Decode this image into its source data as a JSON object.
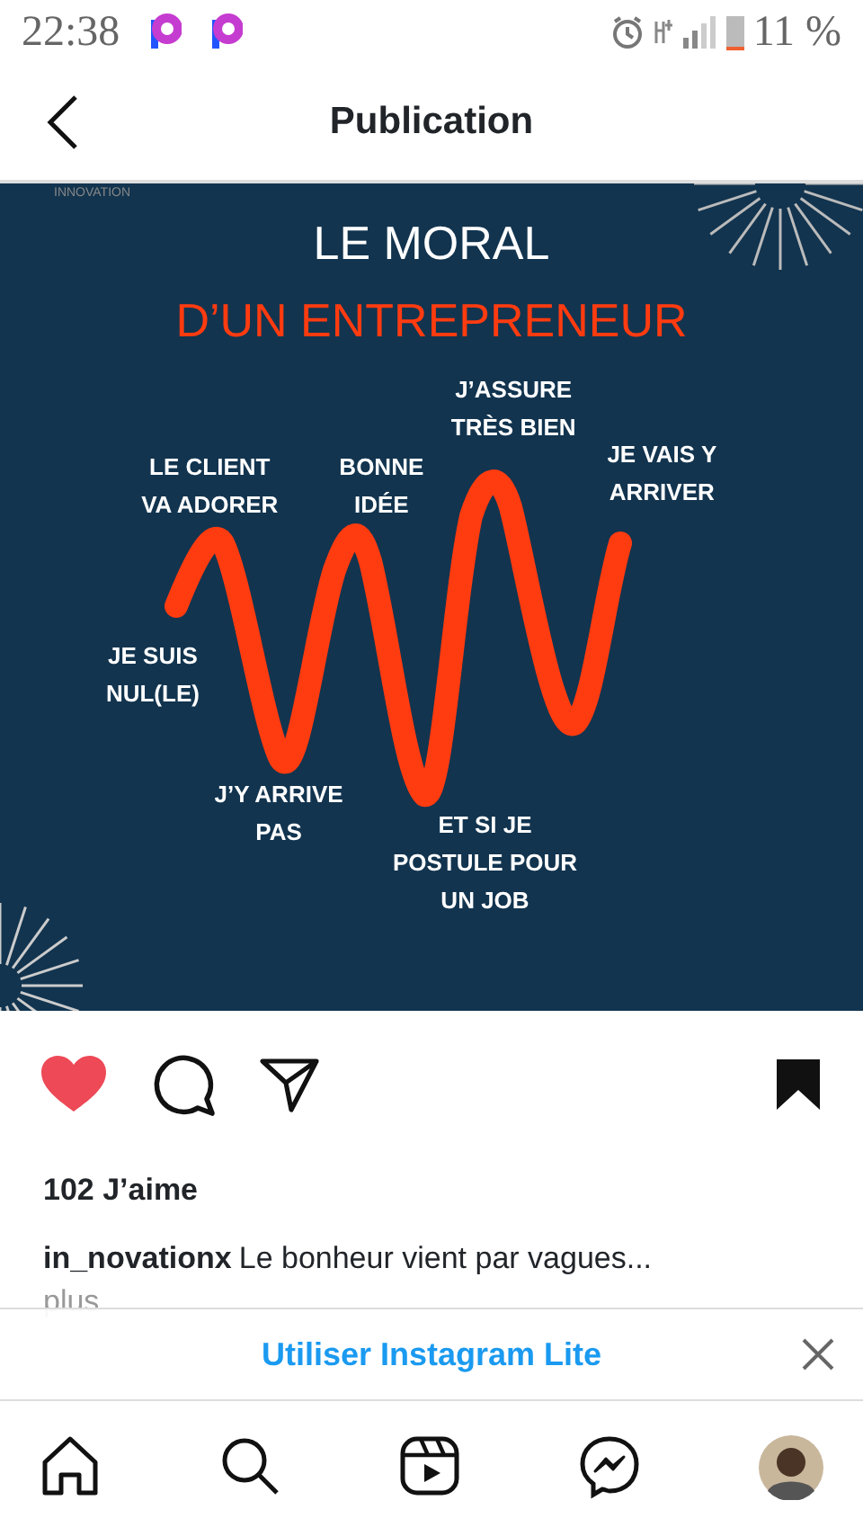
{
  "status_bar": {
    "time": "22:38",
    "battery": "11 %"
  },
  "header": {
    "title": "Publication"
  },
  "post": {
    "logo": "INNOVATION",
    "title": "LE MORAL",
    "subtitle": "D’UN ENTREPRENEUR",
    "labels": [
      {
        "text": "J’ASSURE\nTRÈS BIEN"
      },
      {
        "text": "LE CLIENT\nVA ADORER"
      },
      {
        "text": "BONNE\nIDÉE"
      },
      {
        "text": "JE VAIS Y\nARRIVER"
      },
      {
        "text": "JE SUIS\nNUL(LE)"
      },
      {
        "text": "J’Y ARRIVE\nPAS"
      },
      {
        "text": "ET SI JE\nPOSTULE POUR\nUN JOB"
      }
    ],
    "liked": true,
    "saved": true,
    "likes": "102 J’aime",
    "author": "in_novationx",
    "caption": "Le bonheur vient par vagues...",
    "more": "plus"
  },
  "banner": {
    "text": "Utiliser Instagram Lite"
  },
  "nav": [
    {
      "kind": "home"
    },
    {
      "kind": "search"
    },
    {
      "kind": "reels"
    },
    {
      "kind": "messenger"
    },
    {
      "kind": "profile"
    }
  ]
}
